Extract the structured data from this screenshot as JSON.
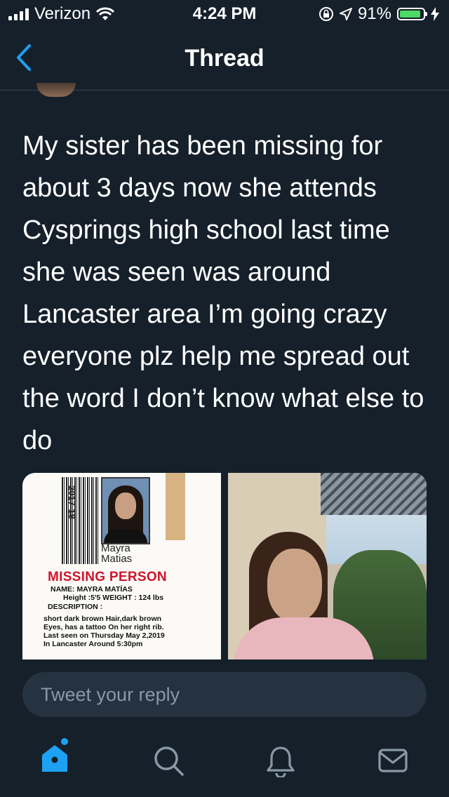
{
  "status": {
    "carrier": "Verizon",
    "time": "4:24 PM",
    "battery_percent": "91%",
    "battery_level": 0.91
  },
  "nav": {
    "title": "Thread",
    "back_icon": "chevron-left-icon"
  },
  "tweet": {
    "text": "My sister has been missing for about 3 days now she attends Cysprings high school last time she was seen was around Lancaster area I’m going crazy everyone plz help me spread out the word I don’t know what else to do"
  },
  "flyer": {
    "id_year": "2017-18",
    "id_name_line1": "Mayra",
    "id_name_line2": "Matias",
    "heading": "MISSING PERSON",
    "name_line": "NAME: MAYRA MATÍAS",
    "height_weight": "Height :5'5    WEIGHT : 124 lbs",
    "description_label": "DESCRIPTION :",
    "desc_1": "short dark brown Hair,dark brown",
    "desc_2": "Eyes, has a tattoo On her right rib.",
    "desc_3": "Last seen on Thursday May 2,2019",
    "desc_4": "In Lancaster   Around 5:30pm"
  },
  "reply": {
    "placeholder": "Tweet your reply"
  },
  "tabs": [
    {
      "name": "home",
      "icon": "home-icon",
      "active": true
    },
    {
      "name": "search",
      "icon": "search-icon",
      "active": false
    },
    {
      "name": "notifications",
      "icon": "bell-icon",
      "active": false
    },
    {
      "name": "messages",
      "icon": "envelope-icon",
      "active": false
    }
  ],
  "colors": {
    "background": "#15202b",
    "accent": "#1da1f2",
    "muted": "#8899a6",
    "divider": "#38444d",
    "missing_heading": "#d0142b"
  }
}
